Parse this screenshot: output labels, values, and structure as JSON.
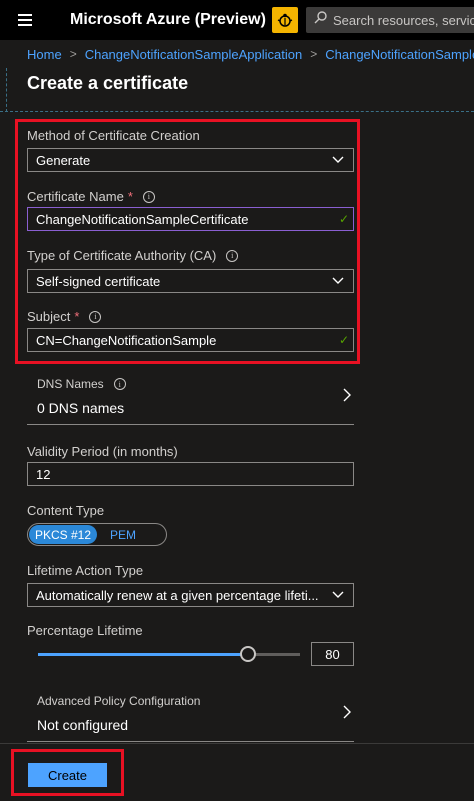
{
  "topbar": {
    "brand": "Microsoft Azure (Preview)",
    "search_placeholder": "Search resources, services, and docs"
  },
  "breadcrumb": {
    "items": [
      "Home",
      "ChangeNotificationSampleApplication",
      "ChangeNotificationSampleApplication"
    ]
  },
  "page": {
    "title": "Create a certificate"
  },
  "form": {
    "method": {
      "label": "Method of Certificate Creation",
      "value": "Generate"
    },
    "cert_name": {
      "label": "Certificate Name",
      "required": "*",
      "value": "ChangeNotificationSampleCertificate"
    },
    "ca_type": {
      "label": "Type of Certificate Authority (CA)",
      "value": "Self-signed certificate"
    },
    "subject": {
      "label": "Subject",
      "required": "*",
      "value": "CN=ChangeNotificationSample"
    },
    "dns": {
      "label": "DNS Names",
      "value": "0 DNS names"
    },
    "validity": {
      "label": "Validity Period (in months)",
      "value": "12"
    },
    "content_type": {
      "label": "Content Type",
      "options": [
        "PKCS #12",
        "PEM"
      ],
      "selected": "PKCS #12"
    },
    "lifetime_action": {
      "label": "Lifetime Action Type",
      "value": "Automatically renew at a given percentage lifeti..."
    },
    "percentage": {
      "label": "Percentage Lifetime",
      "value": "80",
      "fraction": 0.8
    },
    "advanced": {
      "label": "Advanced Policy Configuration",
      "value": "Not configured"
    }
  },
  "footer": {
    "create_label": "Create"
  },
  "colors": {
    "accent": "#4da3ff",
    "highlight": "#e81123",
    "success": "#57a300",
    "focus": "#8a5fd1"
  },
  "icons": [
    "hamburger-icon",
    "bug-icon",
    "search-icon",
    "info-icon",
    "chevron-down-icon",
    "chevron-right-icon",
    "checkmark-icon"
  ]
}
